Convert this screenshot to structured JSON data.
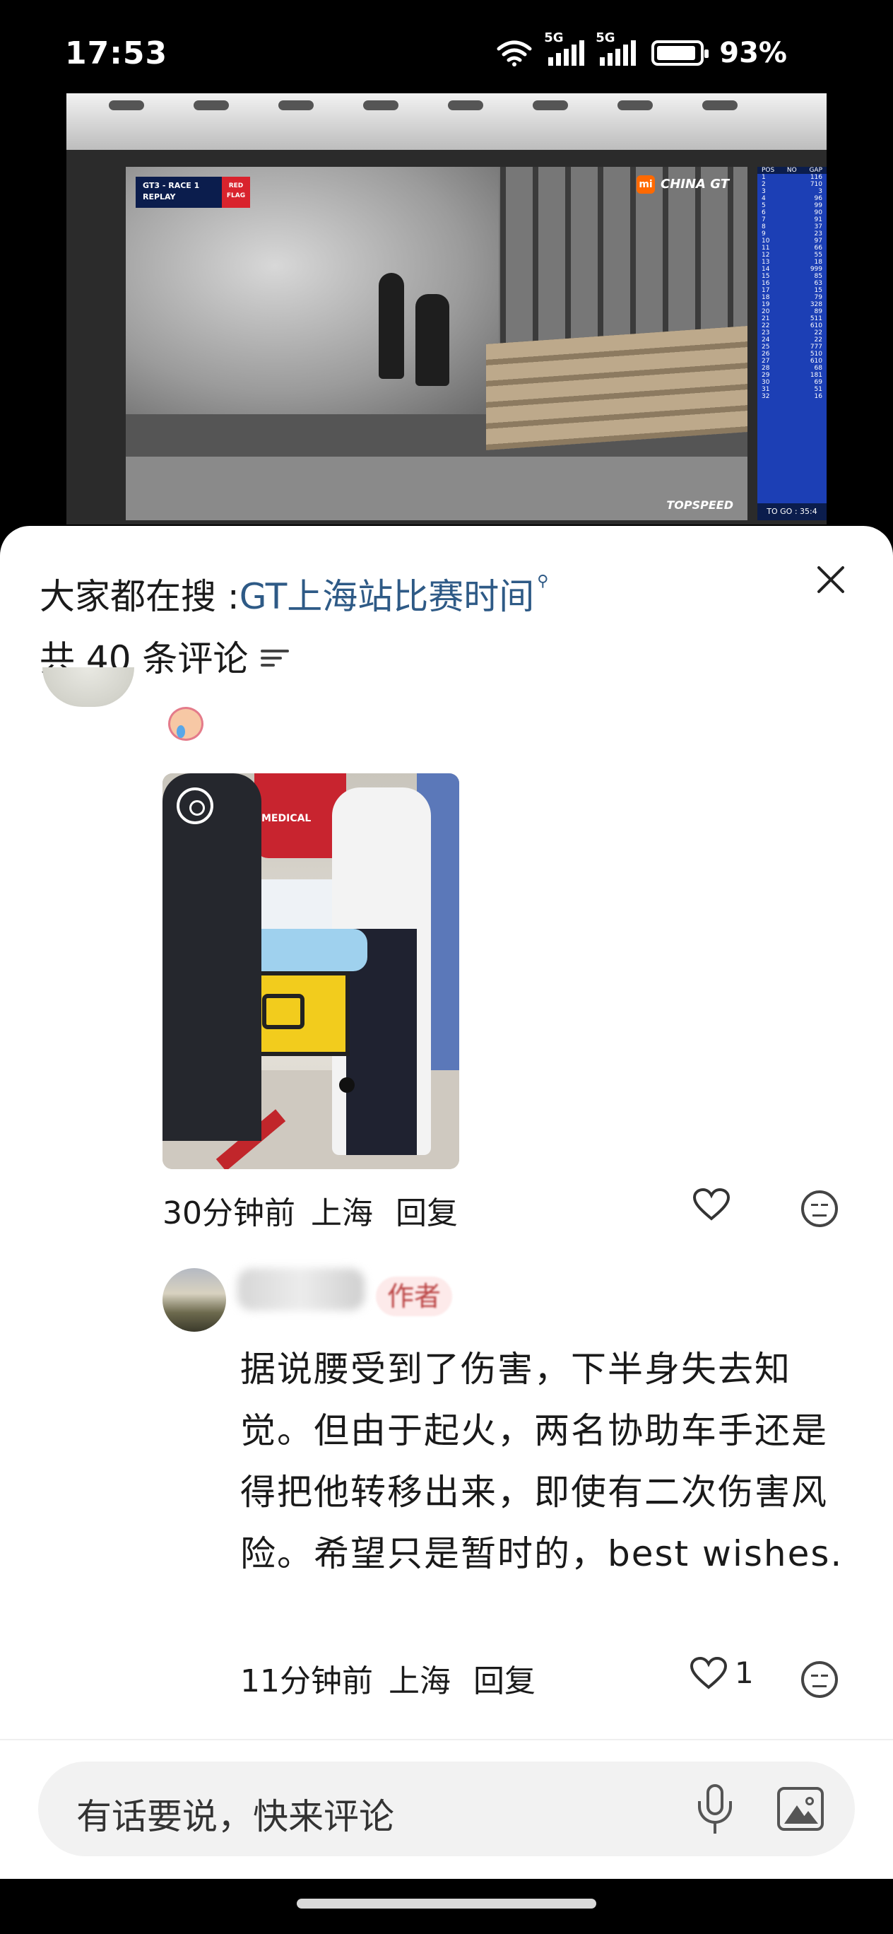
{
  "status_bar": {
    "time": "17:53",
    "network_1": "5G",
    "network_2": "5G",
    "battery": "93%",
    "wifi_icon": "wifi-icon",
    "battery_level": 0.93
  },
  "video": {
    "overlay_line1": "GT3 - RACE 1",
    "overlay_line2": "REPLAY",
    "flag_line1": "RED",
    "flag_line2": "FLAG",
    "brand": "CHINA GT",
    "brand_logo": "mi",
    "watermark": "TOPSPEED",
    "board_header": [
      "POS",
      "NO",
      "GAP"
    ],
    "board_numbers": [
      "116",
      "710",
      "3",
      "96",
      "99",
      "90",
      "91",
      "37",
      "23",
      "97",
      "66",
      "55",
      "18",
      "999",
      "85",
      "63",
      "15",
      "79",
      "328",
      "89",
      "511",
      "610",
      "22",
      "22",
      "777",
      "510",
      "610",
      "68",
      "181",
      "69",
      "51",
      "16"
    ],
    "board_footer": "TO GO : 35:4"
  },
  "sheet": {
    "search_prefix": "大家都在搜 : ",
    "search_link": "GT上海站比赛时间",
    "search_icon": "search-icon",
    "comment_count": "共 40 条评论",
    "filter_icon": "filter-icon",
    "close_icon": "close-icon"
  },
  "comment1": {
    "emoji": "crying-face-emoji",
    "photo_label": "MEDICAL",
    "time": "30分钟前",
    "location": "上海",
    "reply": "回复",
    "like_icon": "heart-icon",
    "emoji_icon": "emoji-icon"
  },
  "comment2": {
    "author_tag": "作者",
    "text": "据说腰受到了伤害，下半身失去知觉。但由于起火，两名协助车手还是得把他转移出来，即使有二次伤害风险。希望只是暂时的，best wishes.",
    "time": "11分钟前",
    "location": "上海",
    "reply": "回复",
    "likes": "1"
  },
  "input": {
    "placeholder": "有话要说，快来评论",
    "mic_icon": "mic-icon",
    "image_icon": "image-icon"
  },
  "colors": {
    "link": "#2e5a86",
    "author_tag_bg": "#fdeaea",
    "author_tag_text": "#b44444"
  }
}
